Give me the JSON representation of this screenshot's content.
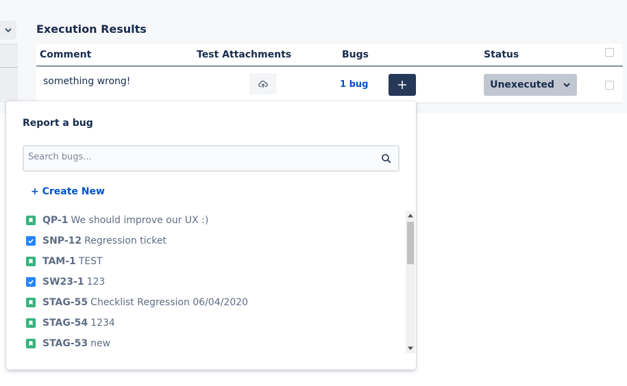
{
  "section": {
    "title": "Execution Results"
  },
  "table": {
    "headers": {
      "comment": "Comment",
      "attachments": "Test Attachments",
      "bugs": "Bugs",
      "status": "Status"
    },
    "row": {
      "comment": "something wrong!",
      "bug_count": "1 bug",
      "status": "Unexecuted"
    }
  },
  "popup": {
    "title": "Report a bug",
    "search_placeholder": "Search bugs...",
    "search_value": "",
    "create_new": "+ Create New",
    "items": [
      {
        "key": "QP-1",
        "summary": "We should improve our UX :)",
        "type": "story-icon",
        "color": "#36b37e"
      },
      {
        "key": "SNP-12",
        "summary": "Regression ticket",
        "type": "task-icon",
        "color": "#2684ff"
      },
      {
        "key": "TAM-1",
        "summary": "TEST",
        "type": "story-icon",
        "color": "#36b37e"
      },
      {
        "key": "SW23-1",
        "summary": "123",
        "type": "task-icon",
        "color": "#2684ff"
      },
      {
        "key": "STAG-55",
        "summary": "Checklist Regression 06/04/2020",
        "type": "story-icon",
        "color": "#36b37e"
      },
      {
        "key": "STAG-54",
        "summary": "1234",
        "type": "story-icon",
        "color": "#36b37e"
      },
      {
        "key": "STAG-53",
        "summary": "new",
        "type": "story-icon",
        "color": "#36b37e"
      }
    ]
  },
  "colors": {
    "primary_dark": "#253858",
    "link": "#0052cc",
    "status_bg": "#c1c7d0",
    "story": "#36b37e",
    "task": "#2684ff"
  }
}
